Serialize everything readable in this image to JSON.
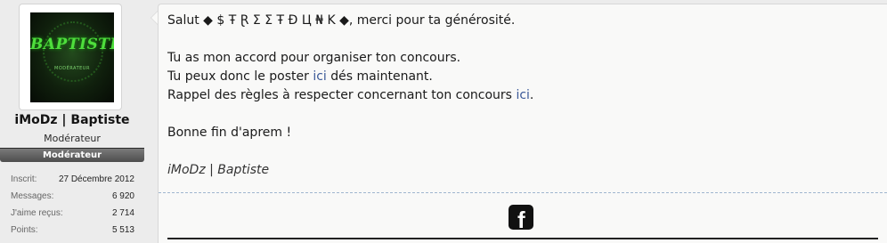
{
  "user": {
    "avatar_title": "BAPTISTE",
    "avatar_subtitle": "MODÉRATEUR",
    "name": "iMoDz | Baptiste",
    "title": "Modérateur",
    "role_banner": "Modérateur",
    "stats": [
      {
        "label": "Inscrit:",
        "value": "27 Décembre 2012"
      },
      {
        "label": "Messages:",
        "value": "6 920"
      },
      {
        "label": "J'aime reçus:",
        "value": "2 714"
      },
      {
        "label": "Points:",
        "value": "5 513"
      }
    ]
  },
  "post": {
    "greeting": "Salut ◆ $ Ŧ Ɽ Σ Σ Ŧ Đ Ц ₦ K ◆, merci pour ta générosité.",
    "line1": "Tu as mon accord pour organiser ton concours.",
    "line2_pre": "Tu peux donc le poster ",
    "line2_link": "ici",
    "line2_post": " dés maintenant.",
    "line3_pre": "Rappel des règles à respecter concernant ton concours ",
    "line3_link": "ici",
    "line3_post": ".",
    "closing": "Bonne fin d'aprem !",
    "signature": "iMoDz | Baptiste"
  },
  "icons": {
    "facebook": "facebook-icon"
  },
  "colors": {
    "link": "#3b5998",
    "separator": "#9fb6cf",
    "role_banner": "#5e5e5e"
  }
}
